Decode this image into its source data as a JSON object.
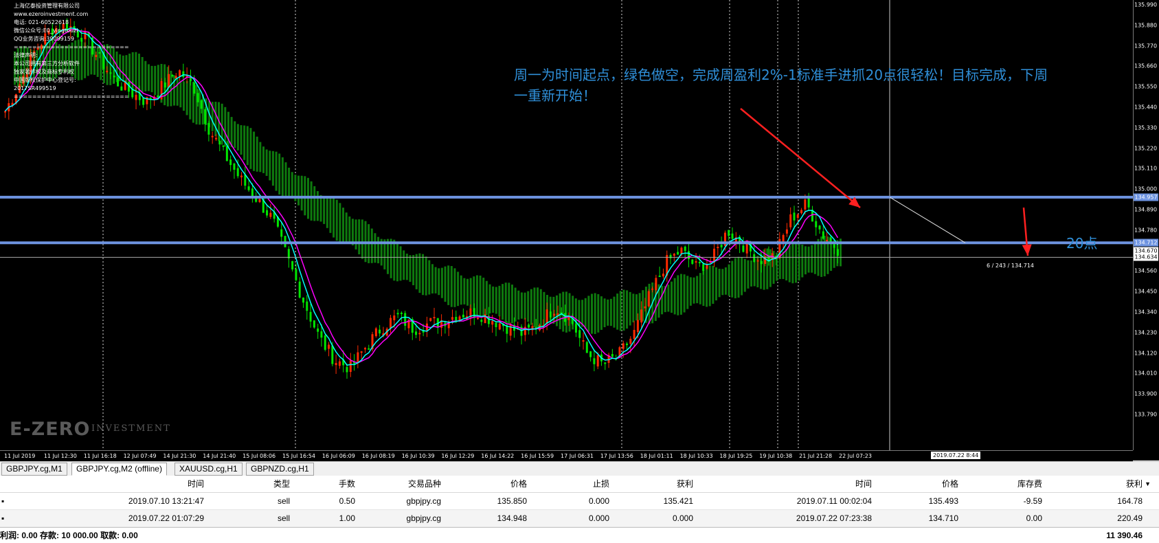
{
  "info_panel": {
    "lines": [
      "上海亿泰投资管理有限公司",
      "www.ezeroinvestment.com",
      "电话: 021-60522618",
      "微信公众号:E0_yingtouzi",
      "QQ业务咨询:39099159",
      "=========================",
      "法律声明:",
      "本公司拥有第三方分析软件",
      "独家著作权及商标专利权",
      "中国版权保护中心登记号:",
      "2017SR499519",
      "========================="
    ]
  },
  "annotation": {
    "line1": "周一为时间起点，绿色做空，完成周盈利2%-1标准手进抓20点很轻松！目标完成，下周",
    "line2": "一重新开始！",
    "points": "20点"
  },
  "watermark": {
    "brand": "E-ZERO",
    "sub": "INVESTMENT"
  },
  "chart_data": {
    "type": "candlestick",
    "symbol": "GBPJPY.cg",
    "timeframe": "M2",
    "price_axis": {
      "min": 133.79,
      "max": 135.99,
      "ticks": [
        "135.990",
        "135.880",
        "135.770",
        "135.660",
        "135.550",
        "135.440",
        "135.330",
        "135.220",
        "135.110",
        "135.000",
        "134.890",
        "134.780",
        "134.670",
        "134.560",
        "134.450",
        "134.340",
        "134.230",
        "134.120",
        "134.010",
        "133.900",
        "133.790"
      ]
    },
    "time_axis": [
      "11 Jul 2019",
      "11 Jul 12:30",
      "11 Jul 16:18",
      "12 Jul 07:49",
      "14 Jul 21:30",
      "14 Jul 21:40",
      "15 Jul 08:06",
      "15 Jul 16:54",
      "16 Jul 06:09",
      "16 Jul 08:19",
      "16 Jul 10:39",
      "16 Jul 12:29",
      "16 Jul 14:22",
      "16 Jul 15:59",
      "17 Jul 06:31",
      "17 Jul 13:56",
      "18 Jul 01:11",
      "18 Jul 10:33",
      "18 Jul 19:25",
      "19 Jul 10:38",
      "21 Jul 21:28",
      "22 Jul 07:23"
    ],
    "horizontal_levels": [
      {
        "price": 134.957,
        "label": "134.957"
      },
      {
        "price": 134.712,
        "label": "134.712"
      }
    ],
    "current_prices": [
      {
        "price": 134.67,
        "label": "134.670"
      },
      {
        "price": 134.634,
        "label": "134.634"
      }
    ],
    "ruler_label": "6 / 243 / 134.714",
    "cursor_time": "2019.07.22 8:44",
    "close_path": [
      135.42,
      135.58,
      135.76,
      135.86,
      135.88,
      135.82,
      135.7,
      135.58,
      135.52,
      135.47,
      135.55,
      135.64,
      135.55,
      135.32,
      135.18,
      135.05,
      134.95,
      134.84,
      134.62,
      134.4,
      134.2,
      134.08,
      134.04,
      134.16,
      134.26,
      134.32,
      134.25,
      134.28,
      134.3,
      134.33,
      134.34,
      134.3,
      134.26,
      134.22,
      134.28,
      134.37,
      134.3,
      134.12,
      134.06,
      134.1,
      134.22,
      134.42,
      134.6,
      134.67,
      134.58,
      134.62,
      134.78,
      134.7,
      134.62,
      134.64,
      134.84,
      134.92,
      134.76,
      134.68
    ],
    "cloud_mid": [
      135.65,
      135.68,
      135.7,
      135.69,
      135.66,
      135.62,
      135.56,
      135.48,
      135.38,
      135.27,
      135.15,
      135.03,
      134.92,
      134.82,
      134.72,
      134.63,
      134.56,
      134.5,
      134.45,
      134.41,
      134.38,
      134.36,
      134.34,
      134.33,
      134.34,
      134.37,
      134.41,
      134.45,
      134.49,
      134.53,
      134.57,
      134.6,
      134.63,
      134.66
    ],
    "colors": {
      "bull": "#ff2a00",
      "bear": "#00e600",
      "cloud": "#0e7a0e",
      "ma_fast": "#00ffff",
      "ma_slow": "#ff00ff",
      "level_line": "#6d93e0"
    }
  },
  "tabs": [
    {
      "label": "GBPJPY.cg,M1",
      "active": false
    },
    {
      "label": "GBPJPY.cg,M2 (offline)",
      "active": true
    },
    {
      "label": "XAUUSD.cg,H1",
      "active": false
    },
    {
      "label": "GBPNZD.cg,H1",
      "active": false
    }
  ],
  "table": {
    "headers": {
      "open_time": "时间",
      "type": "类型",
      "volume": "手数",
      "symbol": "交易品种",
      "open_price": "价格",
      "sl": "止损",
      "tp": "获利",
      "close_time": "时间",
      "close_price": "价格",
      "swap": "库存费",
      "profit": "获利"
    },
    "rows": [
      {
        "open_time": "2019.07.10 13:21:47",
        "type": "sell",
        "volume": "0.50",
        "symbol": "gbpjpy.cg",
        "open_price": "135.850",
        "sl": "0.000",
        "tp": "135.421",
        "close_time": "2019.07.11 00:02:04",
        "close_price": "135.493",
        "swap": "-9.59",
        "profit": "164.78"
      },
      {
        "open_time": "2019.07.22 01:07:29",
        "type": "sell",
        "volume": "1.00",
        "symbol": "gbpjpy.cg",
        "open_price": "134.948",
        "sl": "0.000",
        "tp": "0.000",
        "close_time": "2019.07.22 07:23:38",
        "close_price": "134.710",
        "swap": "0.00",
        "profit": "220.49"
      }
    ],
    "footer": {
      "summary": "利润: 0.00  存款: 10 000.00  取款: 0.00",
      "total": "11 390.46"
    }
  }
}
